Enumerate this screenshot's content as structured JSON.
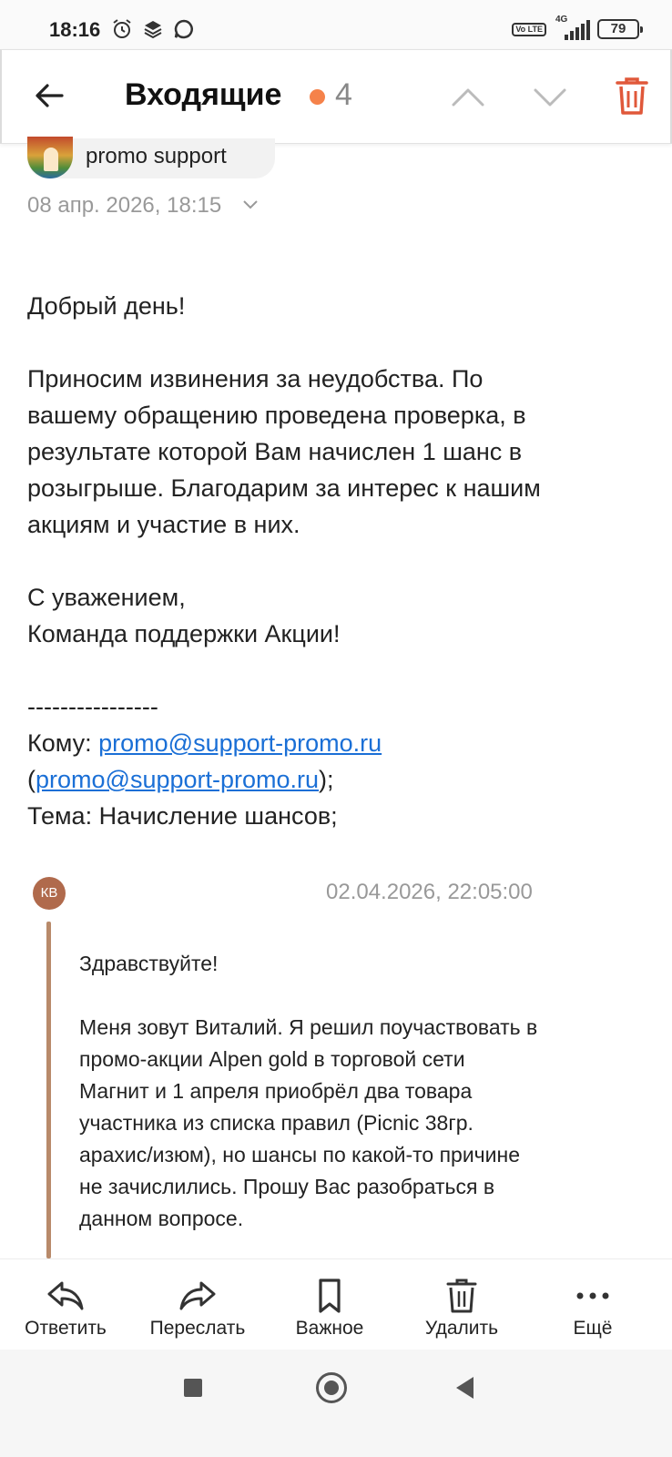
{
  "status_bar": {
    "time": "18:16",
    "volte": "Vo LTE",
    "network": "4G",
    "battery": "79"
  },
  "header": {
    "title": "Входящие",
    "unread_count": "4",
    "dot_color": "#f5824a",
    "accent_delete_color": "#e0583a"
  },
  "message": {
    "sender": "promo support",
    "date": "08 апр. 2026, 18:15",
    "greeting": "Добрый день!",
    "paragraph_lines": [
      "Приносим извинения за неудобства. По",
      "вашему обращению проведена проверка, в",
      "результате которой Вам начислен 1 шанс в",
      "розыгрыше.  Благодарим за интерес к нашим",
      "акциям и участие в них."
    ],
    "sign_1": "С уважением,",
    "sign_2": "Команда поддержки Акции!",
    "separator": "----------------",
    "to_label": "Кому: ",
    "to_email": "promo@support-promo.ru",
    "to_paren_open": "(",
    "to_email_2": "promo@support-promo.ru",
    "to_paren_close": ");",
    "subject": "Тема: Начисление шансов;"
  },
  "quoted": {
    "avatar_initials": "КВ",
    "date": "02.04.2026, 22:05:00",
    "greeting": "Здравствуйте!",
    "lines": [
      "Меня зовут Виталий. Я решил поучаствовать в",
      "промо-акции Alpen gold в торговой сети",
      "Магнит и 1 апреля приобрёл два товара",
      "участника из списка правил (Picnic 38гр.",
      "арахис/изюм), но шансы по какой-то причине",
      "не зачислились. Прошу Вас разобраться в",
      "данном вопросе."
    ]
  },
  "actions": {
    "reply": "Ответить",
    "forward": "Переслать",
    "important": "Важное",
    "delete": "Удалить",
    "more": "Ещё"
  }
}
